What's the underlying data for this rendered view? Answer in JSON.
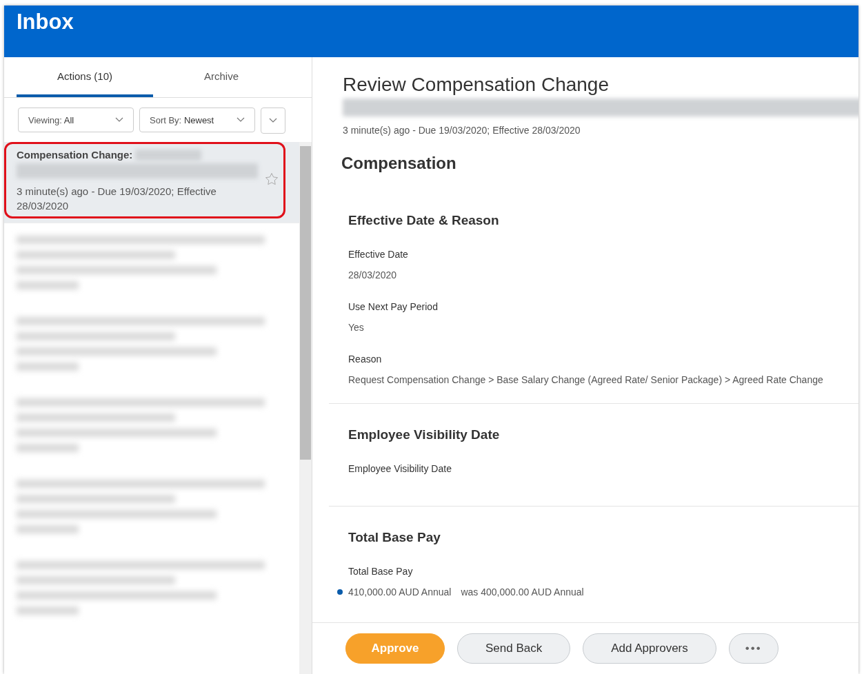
{
  "header": {
    "title": "Inbox"
  },
  "tabs": [
    {
      "label": "Actions (10)",
      "selected": true
    },
    {
      "label": "Archive",
      "selected": false
    }
  ],
  "filters": [
    {
      "label": "Viewing:",
      "value": "All"
    },
    {
      "label": "Sort By:",
      "value": "Newest"
    }
  ],
  "items": [
    {
      "kind": "task",
      "title": "Compensation Change:",
      "meta": "3 minute(s) ago - Due 19/03/2020; Effective 28/03/2020",
      "selected": true,
      "starred": false,
      "highlighted": true
    },
    {
      "kind": "blurred",
      "selected": false
    },
    {
      "kind": "blurred",
      "selected": false
    },
    {
      "kind": "blurred",
      "selected": false
    },
    {
      "kind": "blurred",
      "selected": false
    },
    {
      "kind": "blurred",
      "selected": false
    }
  ],
  "detail": {
    "title": "Review Compensation Change",
    "meta": "3 minute(s) ago - Due 19/03/2020; Effective 28/03/2020",
    "section": "Compensation",
    "groups": [
      {
        "heading": "Effective Date & Reason",
        "fields": [
          {
            "label": "Effective Date",
            "value": "28/03/2020"
          },
          {
            "label": "Use Next Pay Period",
            "value": "Yes"
          },
          {
            "label": "Reason",
            "value": "Request Compensation Change > Base Salary Change (Agreed Rate/ Senior Package) > Agreed Rate Change"
          }
        ]
      },
      {
        "heading": "Employee Visibility Date",
        "fields": [
          {
            "label": "Employee Visibility Date"
          }
        ]
      },
      {
        "heading": "Total Base Pay",
        "fields": [
          {
            "label": "Total Base Pay",
            "value": "410,000.00 AUD Annual",
            "was": "was 400,000.00 AUD Annual",
            "changed": true
          }
        ]
      }
    ]
  },
  "actions": [
    {
      "kind": "primary",
      "label": "Approve"
    },
    {
      "kind": "secondary",
      "label": "Send Back"
    },
    {
      "kind": "secondary",
      "label": "Add Approvers"
    },
    {
      "kind": "more",
      "label": "•••"
    }
  ]
}
